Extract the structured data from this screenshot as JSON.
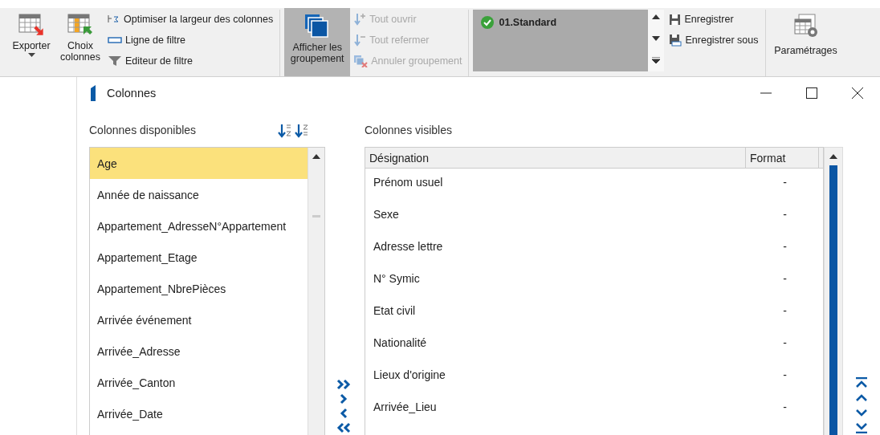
{
  "ribbon": {
    "export": {
      "label": "Exporter"
    },
    "choose_columns": {
      "label": "Choix colonnes"
    },
    "view_tools": [
      {
        "label": "Optimiser la largeur des colonnes"
      },
      {
        "label": "Ligne de filtre"
      },
      {
        "label": "Editeur de filtre"
      }
    ],
    "show_grouping": {
      "label": "Afficher les groupement",
      "selected": true
    },
    "group_tools": [
      {
        "label": "Tout ouvrir",
        "disabled": true
      },
      {
        "label": "Tout refermer",
        "disabled": true
      },
      {
        "label": "Annuler groupement",
        "disabled": true
      }
    ],
    "layouts": [
      {
        "label": "01.Standard"
      }
    ],
    "save_tools": [
      {
        "label": "Enregistrer"
      },
      {
        "label": "Enregistrer sous"
      }
    ],
    "settings": {
      "label": "Paramétrages"
    }
  },
  "dialog": {
    "title": "Colonnes",
    "available": {
      "label": "Colonnes disponibles",
      "items": [
        {
          "label": "Age",
          "selected": true
        },
        {
          "label": "Année de naissance",
          "selected": false
        },
        {
          "label": "Appartement_AdresseN°Appartement",
          "selected": false
        },
        {
          "label": "Appartement_Etage",
          "selected": false
        },
        {
          "label": "Appartement_NbrePièces",
          "selected": false
        },
        {
          "label": "Arrivée événement",
          "selected": false
        },
        {
          "label": "Arrivée_Adresse",
          "selected": false
        },
        {
          "label": "Arrivée_Canton",
          "selected": false
        },
        {
          "label": "Arrivée_Date",
          "selected": false
        }
      ]
    },
    "visible": {
      "label": "Colonnes visibles",
      "columns": [
        "Désignation",
        "Format"
      ],
      "rows": [
        {
          "designation": "Prénom usuel",
          "format": "-"
        },
        {
          "designation": "Sexe",
          "format": "-"
        },
        {
          "designation": "Adresse lettre",
          "format": "-"
        },
        {
          "designation": "N° Symic",
          "format": "-"
        },
        {
          "designation": "Etat civil",
          "format": "-"
        },
        {
          "designation": "Nationalité",
          "format": "-"
        },
        {
          "designation": "Lieux d'origine",
          "format": "-"
        },
        {
          "designation": "Arrivée_Lieu",
          "format": "-"
        }
      ]
    }
  }
}
